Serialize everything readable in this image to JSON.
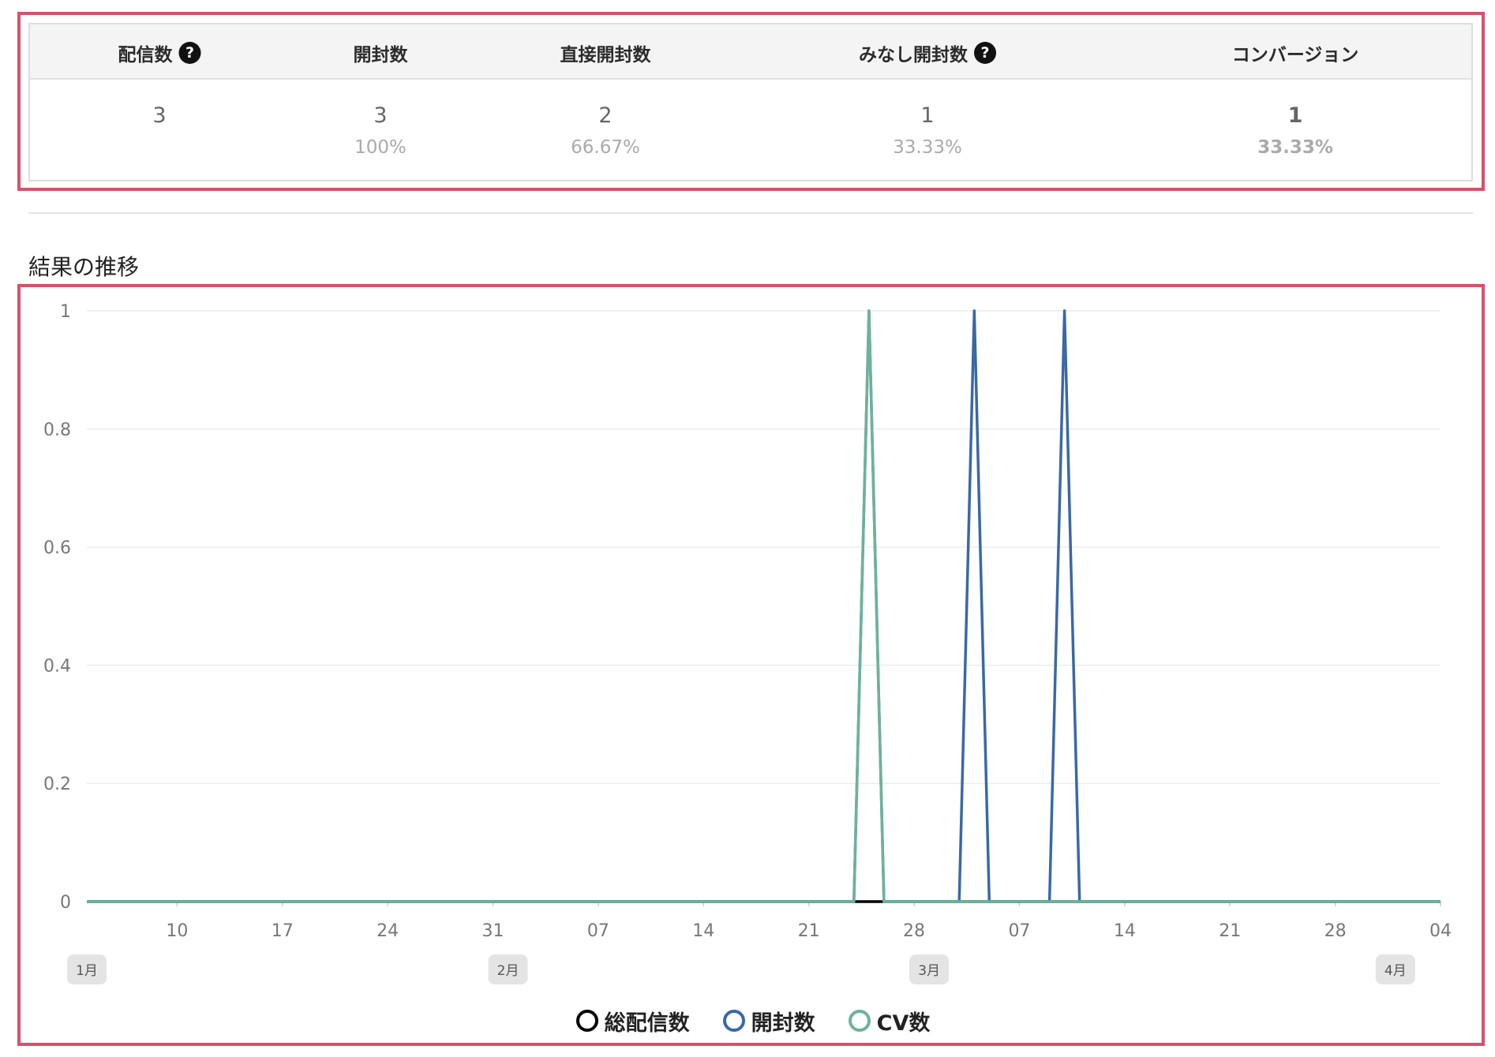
{
  "stats": {
    "columns": [
      {
        "label": "配信数",
        "help": true,
        "value": "3",
        "percent": "",
        "emphasis": false
      },
      {
        "label": "開封数",
        "help": false,
        "value": "3",
        "percent": "100%",
        "emphasis": false
      },
      {
        "label": "直接開封数",
        "help": false,
        "value": "2",
        "percent": "66.67%",
        "emphasis": false
      },
      {
        "label": "みなし開封数",
        "help": true,
        "value": "1",
        "percent": "33.33%",
        "emphasis": false
      },
      {
        "label": "コンバージョン",
        "help": false,
        "value": "1",
        "percent": "33.33%",
        "emphasis": true
      }
    ],
    "help_glyph": "?"
  },
  "section_title": "結果の推移",
  "colors": {
    "highlight_border": "#d9506b",
    "series_total": "#000000",
    "series_open": "#3a68a8",
    "series_cv": "#6db29b",
    "grid": "#ececec",
    "month_badge": "#e4e4e4"
  },
  "chart_data": {
    "type": "line",
    "title": "",
    "xlabel": "",
    "ylabel": "",
    "ylim": [
      0,
      1
    ],
    "y_ticks": [
      "0",
      "0.2",
      "0.4",
      "0.6",
      "0.8",
      "1"
    ],
    "x_range": [
      "2023-01-04",
      "2023-04-04"
    ],
    "x_ticks": [
      {
        "date": "2023-01-10",
        "label": "10"
      },
      {
        "date": "2023-01-17",
        "label": "17"
      },
      {
        "date": "2023-01-24",
        "label": "24"
      },
      {
        "date": "2023-01-31",
        "label": "31"
      },
      {
        "date": "2023-02-07",
        "label": "07"
      },
      {
        "date": "2023-02-14",
        "label": "14"
      },
      {
        "date": "2023-02-21",
        "label": "21"
      },
      {
        "date": "2023-02-28",
        "label": "28"
      },
      {
        "date": "2023-03-07",
        "label": "07"
      },
      {
        "date": "2023-03-14",
        "label": "14"
      },
      {
        "date": "2023-03-21",
        "label": "21"
      },
      {
        "date": "2023-03-28",
        "label": "28"
      },
      {
        "date": "2023-04-04",
        "label": "04"
      }
    ],
    "month_labels": [
      {
        "date": "2023-01-04",
        "label": "1月"
      },
      {
        "date": "2023-02-01",
        "label": "2月"
      },
      {
        "date": "2023-03-01",
        "label": "3月"
      },
      {
        "date": "2023-04-01",
        "label": "4月"
      }
    ],
    "grid": true,
    "legend_position": "bottom-center",
    "series": [
      {
        "name": "総配信数",
        "color": "#000000",
        "points": [
          {
            "x": "2023-01-04",
            "y": 0
          },
          {
            "x": "2023-04-04",
            "y": 0
          }
        ]
      },
      {
        "name": "開封数",
        "color": "#3a68a8",
        "points": [
          {
            "x": "2023-01-04",
            "y": 0
          },
          {
            "x": "2023-02-24",
            "y": 0
          },
          {
            "x": "2023-02-25",
            "y": 1
          },
          {
            "x": "2023-02-26",
            "y": 0
          },
          {
            "x": "2023-03-03",
            "y": 0
          },
          {
            "x": "2023-03-04",
            "y": 1
          },
          {
            "x": "2023-03-05",
            "y": 0
          },
          {
            "x": "2023-03-09",
            "y": 0
          },
          {
            "x": "2023-03-10",
            "y": 1
          },
          {
            "x": "2023-03-11",
            "y": 0
          },
          {
            "x": "2023-04-04",
            "y": 0
          }
        ]
      },
      {
        "name": "CV数",
        "color": "#6db29b",
        "points": [
          {
            "x": "2023-01-04",
            "y": 0
          },
          {
            "x": "2023-02-24",
            "y": 0
          },
          {
            "x": "2023-02-25",
            "y": 1
          },
          {
            "x": "2023-02-26",
            "y": 0
          },
          {
            "x": "2023-04-04",
            "y": 0
          }
        ]
      }
    ]
  }
}
